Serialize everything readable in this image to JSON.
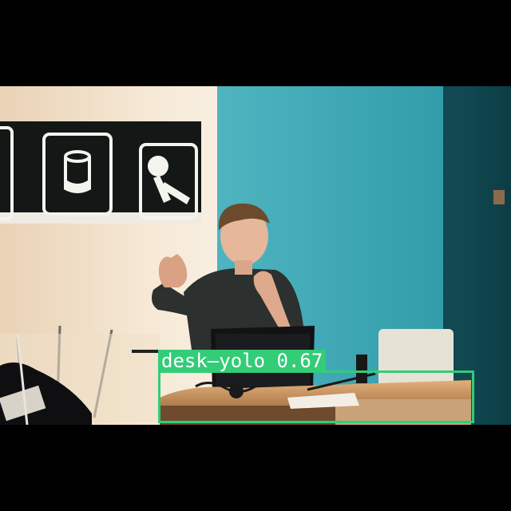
{
  "detections": [
    {
      "class_name": "desk—yolo",
      "confidence": "0.67",
      "color": "#33cc77"
    }
  ],
  "colors": {
    "wall_teal": "#3fa4b1",
    "sign_panel": "#151a18",
    "warm_wall": "#f2e3cc"
  }
}
